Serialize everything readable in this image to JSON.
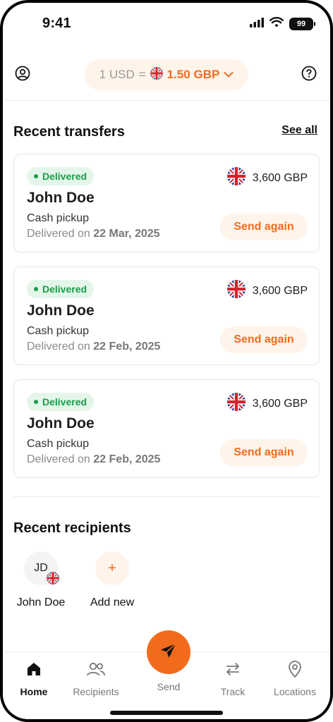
{
  "status_bar": {
    "time": "9:41",
    "battery": "99"
  },
  "header": {
    "rate_from": "1 USD",
    "rate_eq": "=",
    "rate_to": "1.50 GBP",
    "profile_icon": "user-circle-icon",
    "help_icon": "question-circle-icon",
    "dropdown_icon": "chevron-down-icon"
  },
  "recent_transfers": {
    "title": "Recent transfers",
    "see_all": "See all",
    "items": [
      {
        "status": "Delivered",
        "name": "John Doe",
        "amount": "3,600 GBP",
        "method": "Cash pickup",
        "date_prefix": "Delivered on",
        "date": "22 Mar, 2025",
        "action": "Send again"
      },
      {
        "status": "Delivered",
        "name": "John Doe",
        "amount": "3,600 GBP",
        "method": "Cash pickup",
        "date_prefix": "Delivered on",
        "date": "22 Feb, 2025",
        "action": "Send again"
      },
      {
        "status": "Delivered",
        "name": "John Doe",
        "amount": "3,600 GBP",
        "method": "Cash pickup",
        "date_prefix": "Delivered on",
        "date": "22 Feb, 2025",
        "action": "Send again"
      }
    ]
  },
  "recent_recipients": {
    "title": "Recent recipients",
    "items": [
      {
        "initials": "JD",
        "name": "John Doe"
      },
      {
        "initials": "+",
        "name": "Add new"
      }
    ]
  },
  "nav": {
    "home": "Home",
    "recipients": "Recipients",
    "send": "Send",
    "track": "Track",
    "locations": "Locations"
  },
  "colors": {
    "accent": "#f26b1d",
    "accent_soft": "#fff4ea",
    "success": "#1a9c4a",
    "success_soft": "#e4f6ea"
  }
}
